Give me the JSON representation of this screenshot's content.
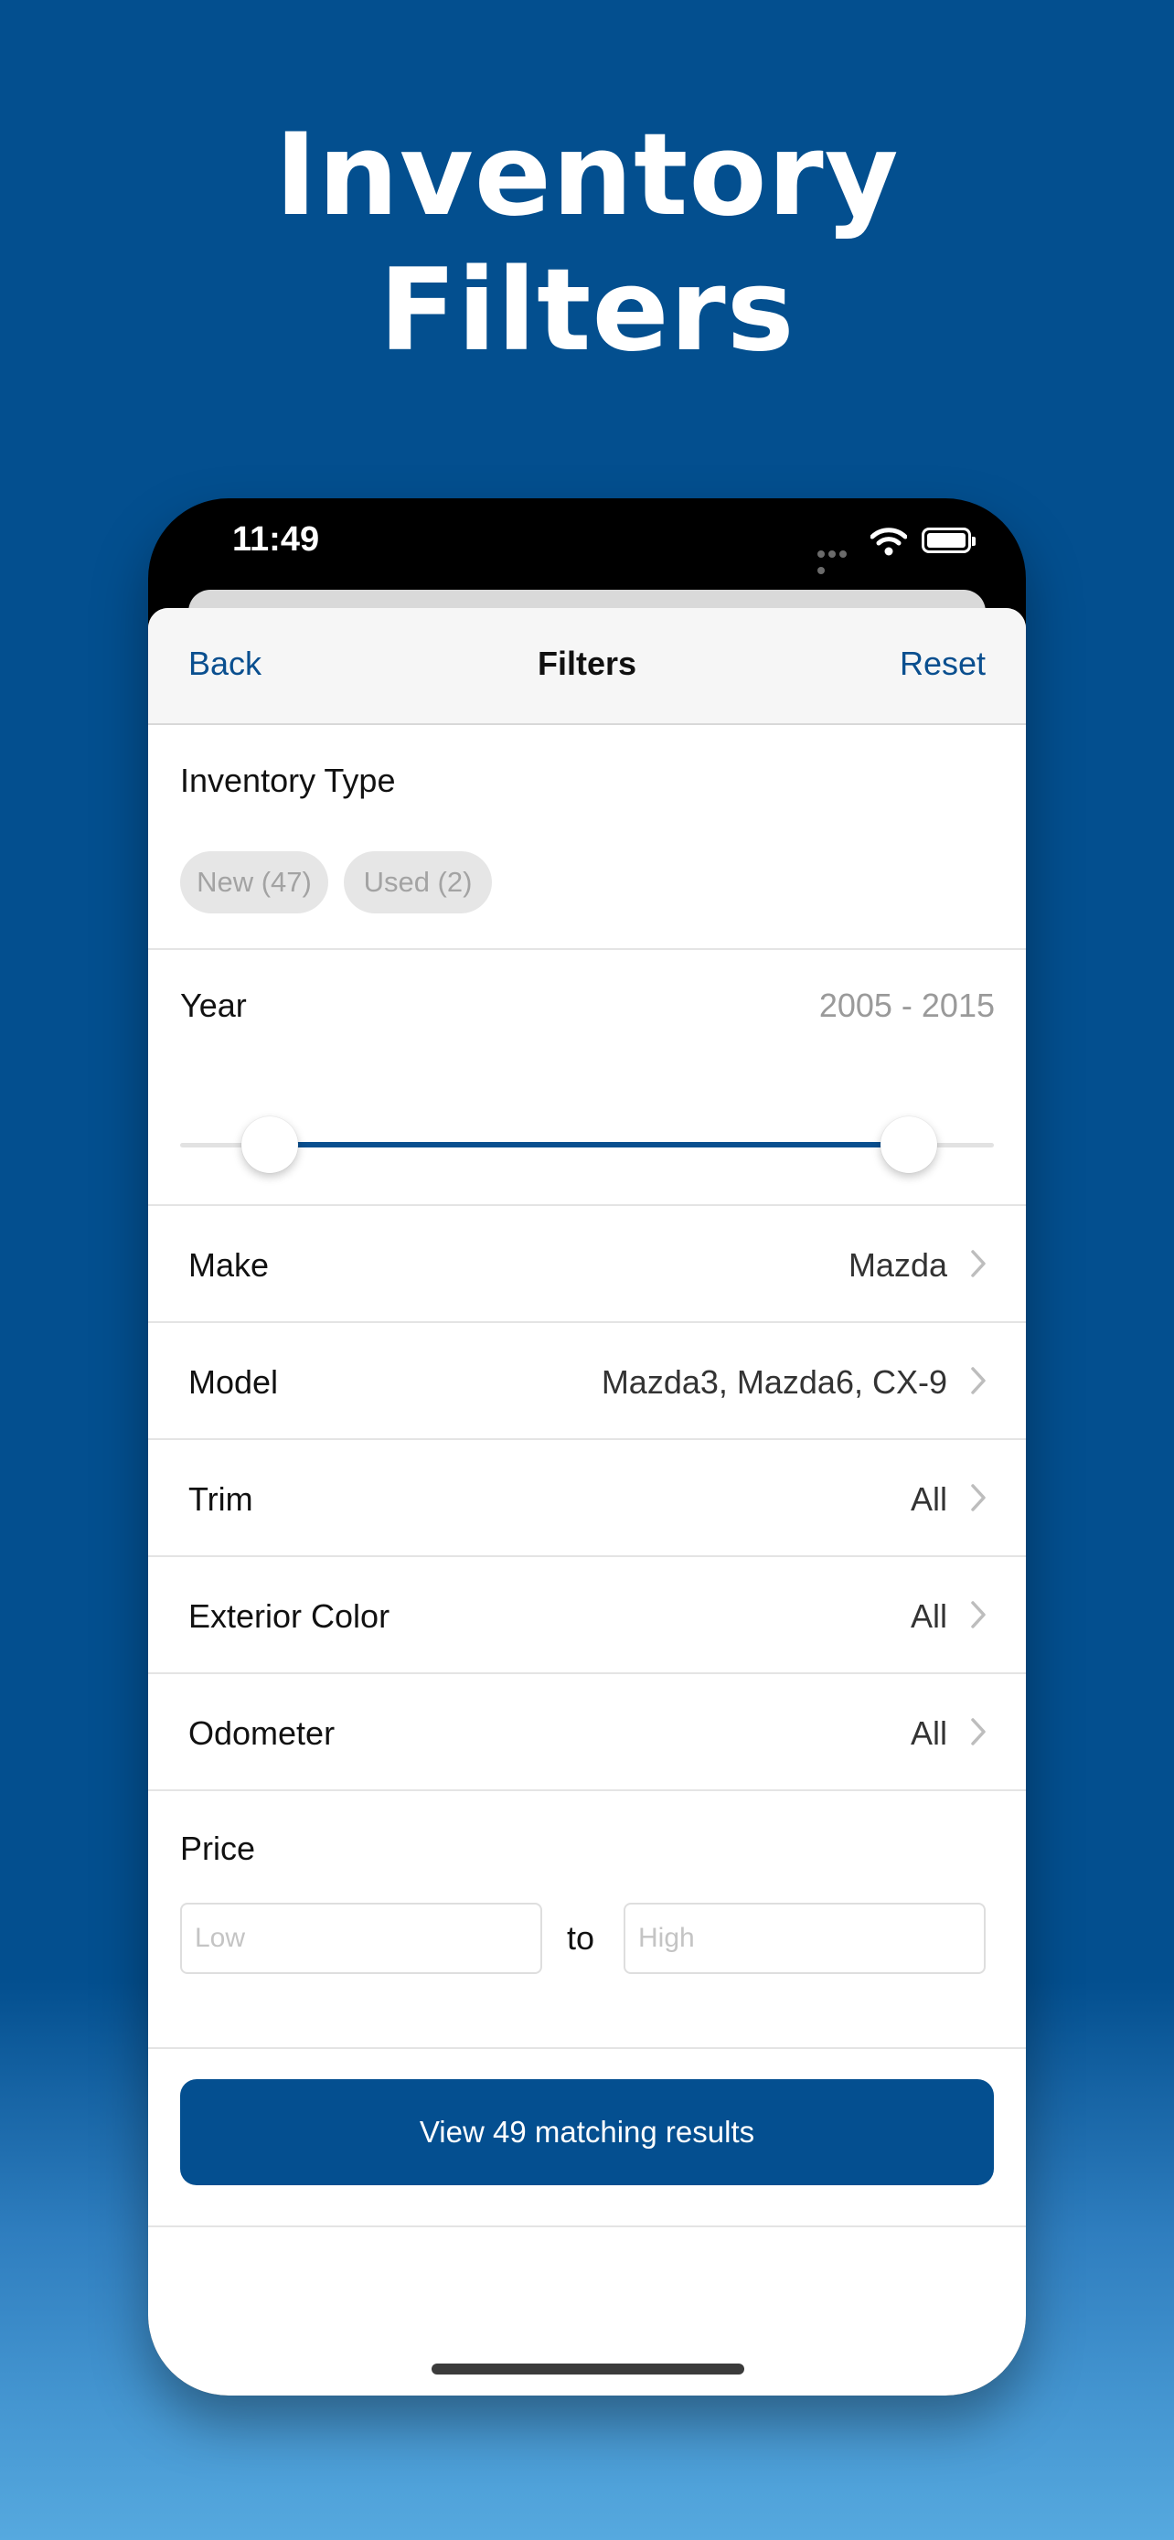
{
  "promo": {
    "title_line1": "Inventory",
    "title_line2": "Filters"
  },
  "status_bar": {
    "time": "11:49",
    "icons": [
      "cellular-signal-icon",
      "wifi-icon",
      "battery-icon"
    ]
  },
  "nav": {
    "back_label": "Back",
    "title": "Filters",
    "reset_label": "Reset"
  },
  "inventory_type": {
    "label": "Inventory Type",
    "chips": [
      "New (47)",
      "Used (2)"
    ]
  },
  "year": {
    "label": "Year",
    "range_text": "2005 - 2015",
    "slider_low_fraction": 0.11,
    "slider_high_fraction": 0.896
  },
  "rows": [
    {
      "label": "Make",
      "value": "Mazda"
    },
    {
      "label": "Model",
      "value": "Mazda3, Mazda6, CX-9"
    },
    {
      "label": "Trim",
      "value": "All"
    },
    {
      "label": "Exterior Color",
      "value": "All"
    },
    {
      "label": "Odometer",
      "value": "All"
    }
  ],
  "price": {
    "label": "Price",
    "low_placeholder": "Low",
    "to_text": "to",
    "high_placeholder": "High"
  },
  "cta": {
    "label": "View 49 matching results"
  },
  "colors": {
    "brand_blue": "#044f90",
    "link_blue": "#0a4f8f",
    "background_top": "#034f8f",
    "background_bottom": "#56a9df"
  }
}
